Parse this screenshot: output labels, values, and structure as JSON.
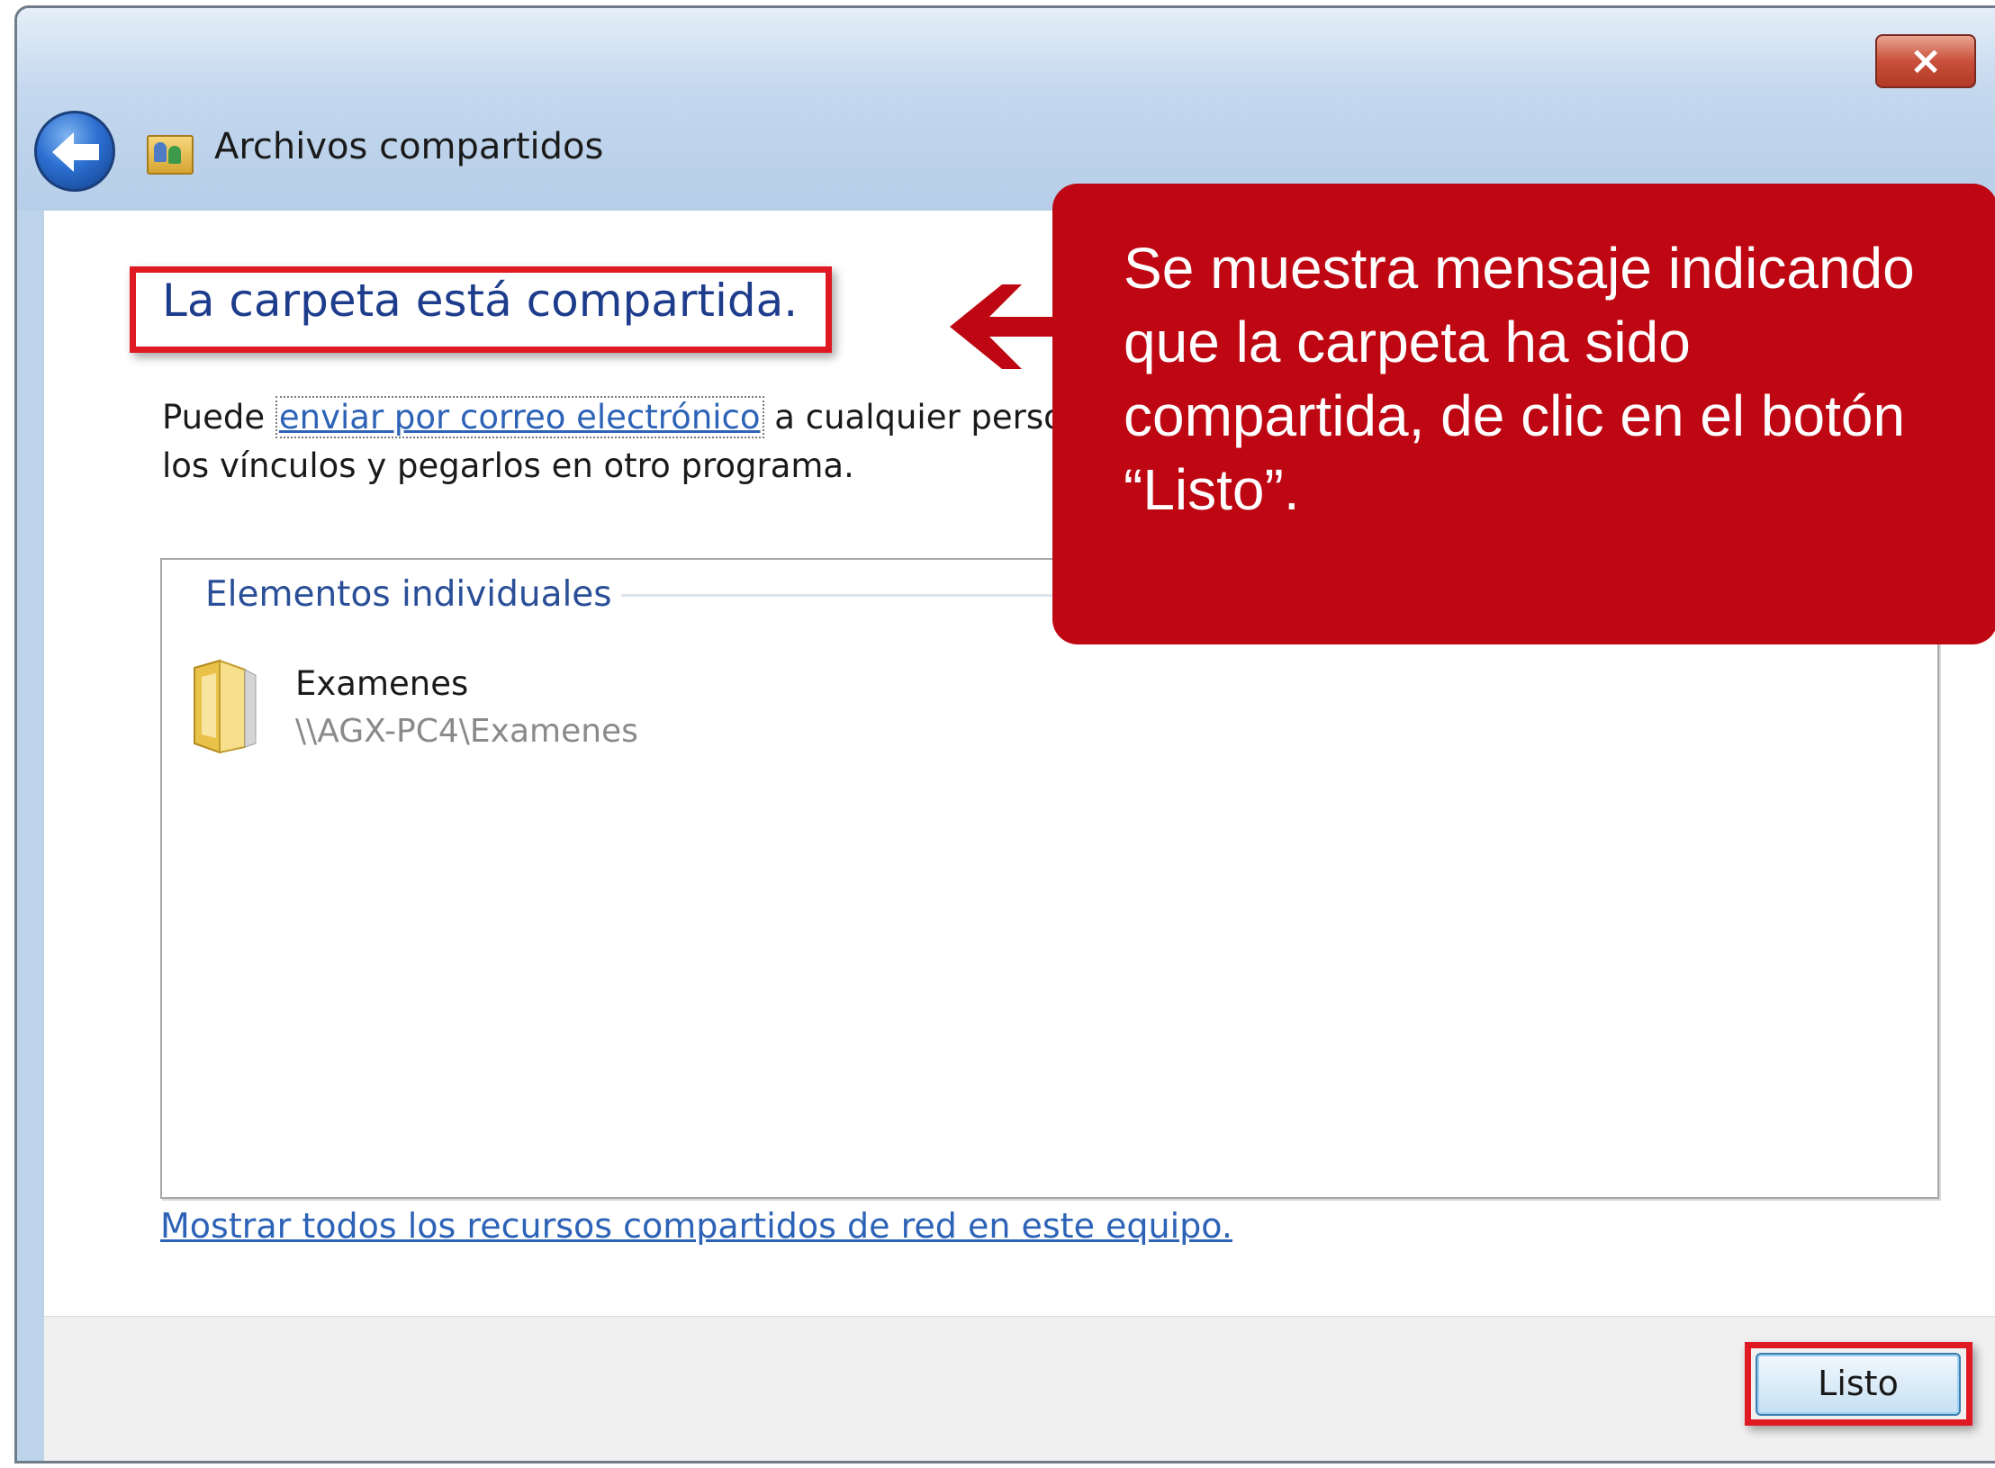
{
  "window": {
    "title": "Archivos compartidos",
    "close_label": "×"
  },
  "main": {
    "heading": "La carpeta está compartida.",
    "description_prefix": "Puede ",
    "description_link": "enviar por correo electrónico",
    "description_suffix": " a cualquier perso",
    "description_line2": "los vínculos y pegarlos en otro programa.",
    "group_title": "Elementos individuales",
    "items": [
      {
        "name": "Examenes",
        "path": "\\\\AGX-PC4\\Examenes",
        "icon": "folder-icon"
      }
    ],
    "show_all_link": "Mostrar todos los recursos compartidos de red en este equipo."
  },
  "footer": {
    "done_button": "Listo"
  },
  "callout": {
    "text": "Se muestra mensaje indicando que la carpeta ha sido compartida, de clic en el botón “Listo”.",
    "color": "#be0712"
  },
  "colors": {
    "highlight": "#e01a22",
    "link": "#2d63b7",
    "heading": "#1e3c8c"
  }
}
